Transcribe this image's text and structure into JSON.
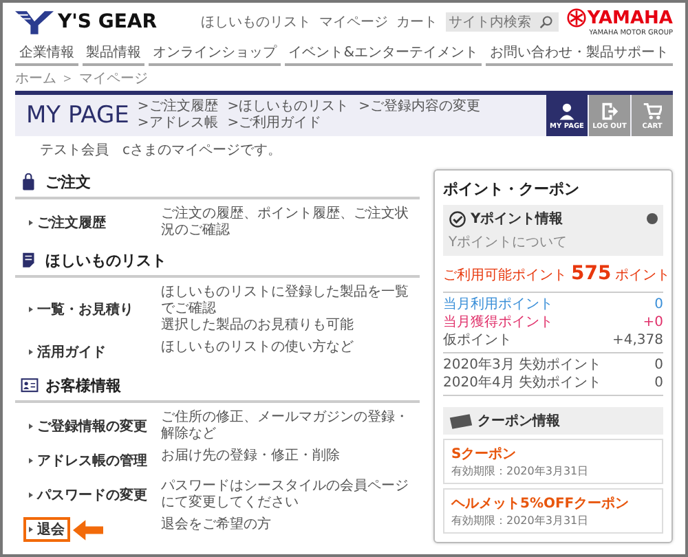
{
  "header": {
    "logo": "Y'S GEAR",
    "top_links": [
      "ほしいものリスト",
      "マイページ",
      "カート"
    ],
    "search": {
      "placeholder": "サイト内検索"
    },
    "brand": {
      "name": "YAMAHA",
      "tagline": "YAMAHA MOTOR GROUP"
    }
  },
  "nav": [
    "企業情報",
    "製品情報",
    "オンラインショップ",
    "イベント&エンターテイメント",
    "お問い合わせ・製品サポート"
  ],
  "breadcrumb": "ホーム ＞ マイページ",
  "mypage_bar": {
    "title": "MY PAGE",
    "links": [
      ">ご注文履歴",
      ">ほしいものリスト",
      ">ご登録内容の変更",
      ">アドレス帳",
      ">ご利用ガイド"
    ],
    "buttons": [
      {
        "label": "MY PAGE",
        "selected": true
      },
      {
        "label": "LOG OUT",
        "selected": false
      },
      {
        "label": "CART",
        "selected": false
      }
    ]
  },
  "greeting": "テスト会員　cさまのマイページです。",
  "sections": [
    {
      "title": "ご注文",
      "items": [
        {
          "label": "ご注文履歴",
          "description": [
            "ご注文の履歴、ポイント履歴、ご注文状況のご確認"
          ],
          "highlighted": false
        }
      ]
    },
    {
      "title": "ほしいものリスト",
      "items": [
        {
          "label": "一覧・お見積り",
          "description": [
            "ほしいものリストに登録した製品を一覧でご確認",
            "選択した製品のお見積りも可能"
          ],
          "highlighted": false
        },
        {
          "label": "活用ガイド",
          "description": [
            "ほしいものリストの使い方など"
          ],
          "highlighted": false
        }
      ]
    },
    {
      "title": "お客様情報",
      "items": [
        {
          "label": "ご登録情報の変更",
          "description": [
            "ご住所の修正、メールマガジンの登録・解除など"
          ],
          "highlighted": false
        },
        {
          "label": "アドレス帳の管理",
          "description": [
            "お届け先の登録・修正・削除"
          ],
          "highlighted": false
        },
        {
          "label": "パスワードの変更",
          "description": [
            "パスワードはシースタイルの会員ページにて変更してください"
          ],
          "highlighted": false
        },
        {
          "label": "退会",
          "description": [
            "退会をご希望の方"
          ],
          "highlighted": true
        }
      ]
    }
  ],
  "points": {
    "title": "ポイント・クーポン",
    "info_title": "Yポイント情報",
    "help_link": "Yポイントについて",
    "available": {
      "label": "ご利用可能ポイント",
      "value": "575",
      "unit": "ポイント"
    },
    "rows": [
      {
        "label": "当月利用ポイント",
        "value": "0",
        "kind": "used"
      },
      {
        "label": "当月獲得ポイント",
        "value": "+0",
        "kind": "earned"
      },
      {
        "label": "仮ポイント",
        "value": "+4,378",
        "kind": "plain"
      }
    ],
    "expiry": [
      {
        "label": "2020年3月 失効ポイント",
        "value": "0"
      },
      {
        "label": "2020年4月 失効ポイント",
        "value": "0"
      }
    ]
  },
  "coupons": {
    "title": "クーポン情報",
    "items": [
      {
        "name": "Sクーポン",
        "expiry": "有効期限：2020年3月31日"
      },
      {
        "name": "ヘルメット5%OFFクーポン",
        "expiry": "有効期限：2020年3月31日"
      }
    ]
  }
}
